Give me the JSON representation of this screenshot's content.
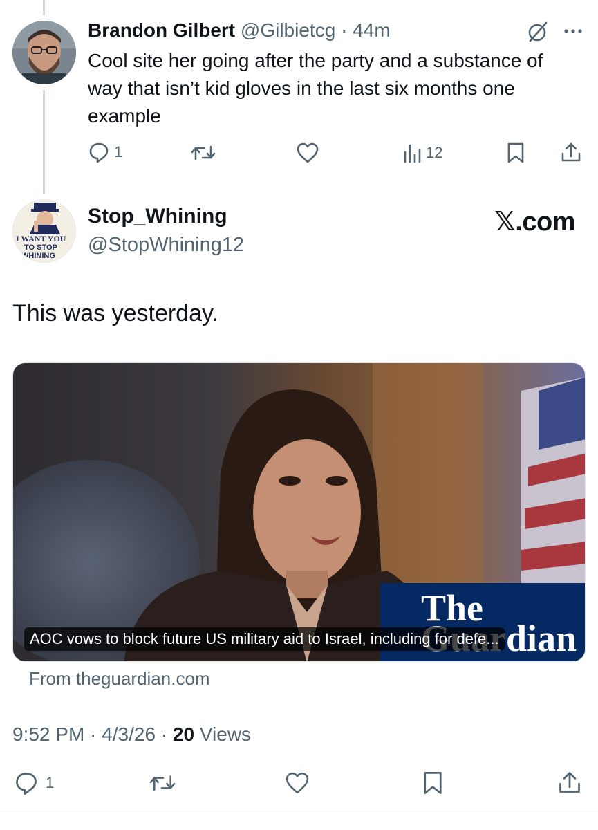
{
  "reply": {
    "name": "Brandon Gilbert",
    "handle": "@Gilbietcg",
    "separator": "·",
    "time": "44m",
    "text": "Cool site her going after the party and a substance of way that isn’t kid gloves in the last six months one example",
    "actions": {
      "replies": "1",
      "reposts": "",
      "likes": "",
      "views": "12"
    },
    "icons": [
      "grok-icon",
      "more-icon",
      "reply-icon",
      "repost-icon",
      "like-icon",
      "views-icon",
      "bookmark-icon",
      "share-icon"
    ]
  },
  "post": {
    "name": "Stop_Whining",
    "handle": "@StopWhining12",
    "brand": "𝕏.com",
    "avatar_text": {
      "line1": "I WANT YOU",
      "line2": "TO STOP",
      "line3": "WHINING"
    },
    "text": "This was yesterday.",
    "card": {
      "caption": "AOC vows to block future US military aid to Israel, including for defe...",
      "logo_line1": "The",
      "logo_line2": "Guardian",
      "source": "From theguardian.com"
    },
    "meta": {
      "time": "9:52 PM",
      "sep1": " · ",
      "date": "4/3/26",
      "sep2": " · ",
      "views_count": "20",
      "views_label": " Views"
    },
    "actions": {
      "replies": "1"
    }
  },
  "colors": {
    "text": "#0f1419",
    "muted": "#536471",
    "guardian_blue": "#052962",
    "thread_line": "#cfd9de"
  }
}
